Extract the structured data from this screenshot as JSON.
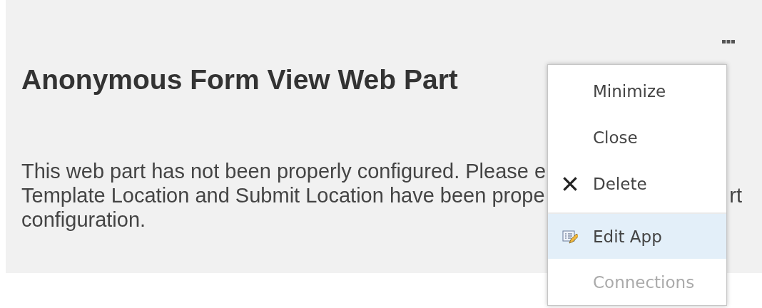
{
  "web_part": {
    "title": "Anonymous Form View Web Part",
    "message_lines": [
      {
        "text": "This web part has not been properly configured. Please e"
      },
      {
        "text": "Template Location and Submit Location have been prope",
        "tail": "rt"
      },
      {
        "text": "configuration."
      }
    ]
  },
  "menu": {
    "items": [
      {
        "label": "Minimize",
        "kind": "text",
        "selected": false,
        "disabled": false,
        "separated": false
      },
      {
        "label": "Close",
        "kind": "text",
        "selected": false,
        "disabled": false,
        "separated": false
      },
      {
        "label": "Delete",
        "kind": "cross",
        "selected": false,
        "disabled": false,
        "separated": false
      },
      {
        "label": "Edit App",
        "kind": "edit",
        "selected": true,
        "disabled": false,
        "separated": true
      },
      {
        "label": "Connections",
        "kind": "text",
        "selected": false,
        "disabled": true,
        "separated": false
      }
    ]
  }
}
